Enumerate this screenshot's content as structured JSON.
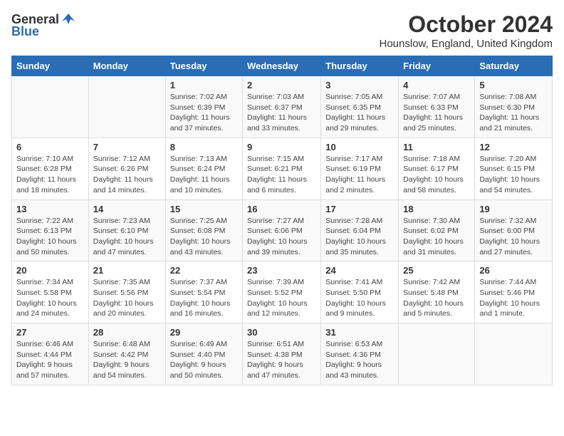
{
  "header": {
    "logo_general": "General",
    "logo_blue": "Blue",
    "month_title": "October 2024",
    "location": "Hounslow, England, United Kingdom"
  },
  "days_of_week": [
    "Sunday",
    "Monday",
    "Tuesday",
    "Wednesday",
    "Thursday",
    "Friday",
    "Saturday"
  ],
  "weeks": [
    [
      {
        "day": "",
        "detail": ""
      },
      {
        "day": "",
        "detail": ""
      },
      {
        "day": "1",
        "detail": "Sunrise: 7:02 AM\nSunset: 6:39 PM\nDaylight: 11 hours and 37 minutes."
      },
      {
        "day": "2",
        "detail": "Sunrise: 7:03 AM\nSunset: 6:37 PM\nDaylight: 11 hours and 33 minutes."
      },
      {
        "day": "3",
        "detail": "Sunrise: 7:05 AM\nSunset: 6:35 PM\nDaylight: 11 hours and 29 minutes."
      },
      {
        "day": "4",
        "detail": "Sunrise: 7:07 AM\nSunset: 6:33 PM\nDaylight: 11 hours and 25 minutes."
      },
      {
        "day": "5",
        "detail": "Sunrise: 7:08 AM\nSunset: 6:30 PM\nDaylight: 11 hours and 21 minutes."
      }
    ],
    [
      {
        "day": "6",
        "detail": "Sunrise: 7:10 AM\nSunset: 6:28 PM\nDaylight: 11 hours and 18 minutes."
      },
      {
        "day": "7",
        "detail": "Sunrise: 7:12 AM\nSunset: 6:26 PM\nDaylight: 11 hours and 14 minutes."
      },
      {
        "day": "8",
        "detail": "Sunrise: 7:13 AM\nSunset: 6:24 PM\nDaylight: 11 hours and 10 minutes."
      },
      {
        "day": "9",
        "detail": "Sunrise: 7:15 AM\nSunset: 6:21 PM\nDaylight: 11 hours and 6 minutes."
      },
      {
        "day": "10",
        "detail": "Sunrise: 7:17 AM\nSunset: 6:19 PM\nDaylight: 11 hours and 2 minutes."
      },
      {
        "day": "11",
        "detail": "Sunrise: 7:18 AM\nSunset: 6:17 PM\nDaylight: 10 hours and 58 minutes."
      },
      {
        "day": "12",
        "detail": "Sunrise: 7:20 AM\nSunset: 6:15 PM\nDaylight: 10 hours and 54 minutes."
      }
    ],
    [
      {
        "day": "13",
        "detail": "Sunrise: 7:22 AM\nSunset: 6:13 PM\nDaylight: 10 hours and 50 minutes."
      },
      {
        "day": "14",
        "detail": "Sunrise: 7:23 AM\nSunset: 6:10 PM\nDaylight: 10 hours and 47 minutes."
      },
      {
        "day": "15",
        "detail": "Sunrise: 7:25 AM\nSunset: 6:08 PM\nDaylight: 10 hours and 43 minutes."
      },
      {
        "day": "16",
        "detail": "Sunrise: 7:27 AM\nSunset: 6:06 PM\nDaylight: 10 hours and 39 minutes."
      },
      {
        "day": "17",
        "detail": "Sunrise: 7:28 AM\nSunset: 6:04 PM\nDaylight: 10 hours and 35 minutes."
      },
      {
        "day": "18",
        "detail": "Sunrise: 7:30 AM\nSunset: 6:02 PM\nDaylight: 10 hours and 31 minutes."
      },
      {
        "day": "19",
        "detail": "Sunrise: 7:32 AM\nSunset: 6:00 PM\nDaylight: 10 hours and 27 minutes."
      }
    ],
    [
      {
        "day": "20",
        "detail": "Sunrise: 7:34 AM\nSunset: 5:58 PM\nDaylight: 10 hours and 24 minutes."
      },
      {
        "day": "21",
        "detail": "Sunrise: 7:35 AM\nSunset: 5:56 PM\nDaylight: 10 hours and 20 minutes."
      },
      {
        "day": "22",
        "detail": "Sunrise: 7:37 AM\nSunset: 5:54 PM\nDaylight: 10 hours and 16 minutes."
      },
      {
        "day": "23",
        "detail": "Sunrise: 7:39 AM\nSunset: 5:52 PM\nDaylight: 10 hours and 12 minutes."
      },
      {
        "day": "24",
        "detail": "Sunrise: 7:41 AM\nSunset: 5:50 PM\nDaylight: 10 hours and 9 minutes."
      },
      {
        "day": "25",
        "detail": "Sunrise: 7:42 AM\nSunset: 5:48 PM\nDaylight: 10 hours and 5 minutes."
      },
      {
        "day": "26",
        "detail": "Sunrise: 7:44 AM\nSunset: 5:46 PM\nDaylight: 10 hours and 1 minute."
      }
    ],
    [
      {
        "day": "27",
        "detail": "Sunrise: 6:46 AM\nSunset: 4:44 PM\nDaylight: 9 hours and 57 minutes."
      },
      {
        "day": "28",
        "detail": "Sunrise: 6:48 AM\nSunset: 4:42 PM\nDaylight: 9 hours and 54 minutes."
      },
      {
        "day": "29",
        "detail": "Sunrise: 6:49 AM\nSunset: 4:40 PM\nDaylight: 9 hours and 50 minutes."
      },
      {
        "day": "30",
        "detail": "Sunrise: 6:51 AM\nSunset: 4:38 PM\nDaylight: 9 hours and 47 minutes."
      },
      {
        "day": "31",
        "detail": "Sunrise: 6:53 AM\nSunset: 4:36 PM\nDaylight: 9 hours and 43 minutes."
      },
      {
        "day": "",
        "detail": ""
      },
      {
        "day": "",
        "detail": ""
      }
    ]
  ]
}
